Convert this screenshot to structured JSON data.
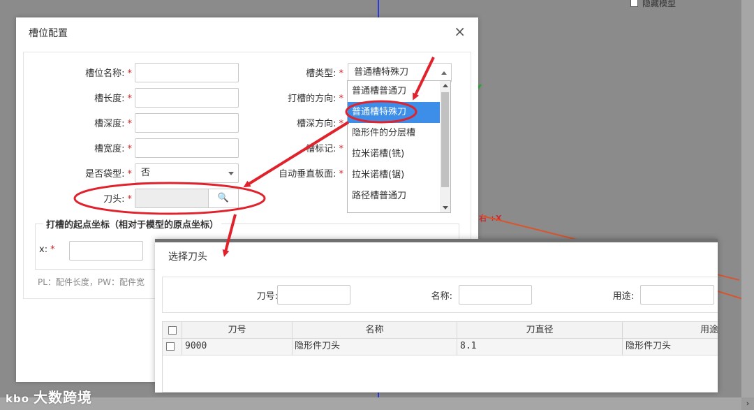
{
  "viewport": {
    "hide_model_label": "隐藏模型",
    "axis_label": "右 +X"
  },
  "slot_dialog": {
    "title": "槽位配置",
    "close_symbol": "×",
    "fields": {
      "slot_name": "槽位名称:",
      "slot_length": "槽长度:",
      "slot_depth": "槽深度:",
      "slot_width": "槽宽度:",
      "is_pocket": "是否袋型:",
      "is_pocket_value": "否",
      "tool_head": "刀头:",
      "slot_type": "槽类型:",
      "slot_type_value": "普通槽特殊刀",
      "groove_direction": "打槽的方向:",
      "depth_direction": "槽深方向:",
      "slot_mark": "槽标记:",
      "auto_vertical": "自动垂直板面:"
    },
    "required_mark": "*",
    "section_legend": "打槽的起点坐标（相对于模型的原点坐标）",
    "x_label": "x:",
    "note": "PL：配件长度，PW：配件宽",
    "search_icon": "🔍"
  },
  "dropdown": {
    "options": [
      "普通槽普通刀",
      "普通槽特殊刀",
      "隐形件的分层槽",
      "拉米诺槽(铣)",
      "拉米诺槽(锯)",
      "路径槽普通刀"
    ],
    "selected_index": 1
  },
  "tool_dialog": {
    "title": "选择刀头",
    "filters": {
      "tool_no": "刀号:",
      "name": "名称:",
      "usage": "用途:"
    },
    "columns": [
      "刀号",
      "名称",
      "刀直径",
      "用途"
    ],
    "rows": [
      {
        "tool_no": "9000",
        "name": "隐形件刀头",
        "diameter": "8.1",
        "usage": "隐形件刀头"
      }
    ]
  },
  "colors": {
    "selected_option": "#3d8ee8",
    "annotation_red": "#e0222c",
    "required": "#d0282e"
  },
  "watermark": "大数跨境",
  "watermark_logo": "kbo"
}
